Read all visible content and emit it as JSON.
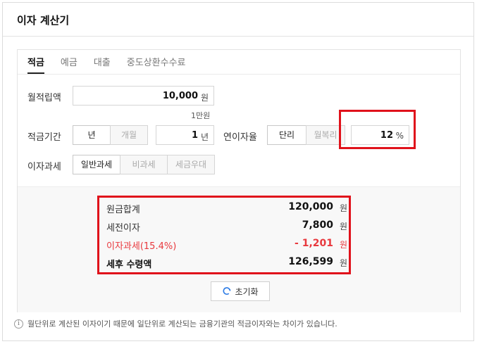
{
  "header": {
    "title": "이자 계산기"
  },
  "tabs": [
    {
      "label": "적금",
      "active": true
    },
    {
      "label": "예금",
      "active": false
    },
    {
      "label": "대출",
      "active": false
    },
    {
      "label": "중도상환수수료",
      "active": false
    }
  ],
  "form": {
    "monthly_label": "월적립액",
    "monthly_value": "10,000",
    "monthly_unit": "원",
    "monthly_hint": "1만원",
    "period_label": "적금기간",
    "period_options": [
      "년",
      "개월"
    ],
    "period_selected": "년",
    "period_value": "1",
    "period_unit": "년",
    "rate_label": "연이자율",
    "rate_options": [
      "단리",
      "월복리"
    ],
    "rate_selected": "단리",
    "rate_value": "12",
    "rate_unit": "%",
    "tax_label": "이자과세",
    "tax_options": [
      "일반과세",
      "비과세",
      "세금우대"
    ],
    "tax_selected": "일반과세"
  },
  "results": {
    "principal_label": "원금합계",
    "principal_value": "120,000",
    "principal_unit": "원",
    "pretax_label": "세전이자",
    "pretax_value": "7,800",
    "pretax_unit": "원",
    "tax_label": "이자과세(15.4%)",
    "tax_value": "- 1,201",
    "tax_unit": "원",
    "net_label": "세후 수령액",
    "net_value": "126,599",
    "net_unit": "원"
  },
  "reset_label": "초기화",
  "footnote": "월단위로 계산된 이자이기 때문에 일단위로 계산되는 금융기관의 적금이자와는 차이가 있습니다.",
  "colors": {
    "highlight": "#e0121b",
    "negative": "#e8383d"
  }
}
